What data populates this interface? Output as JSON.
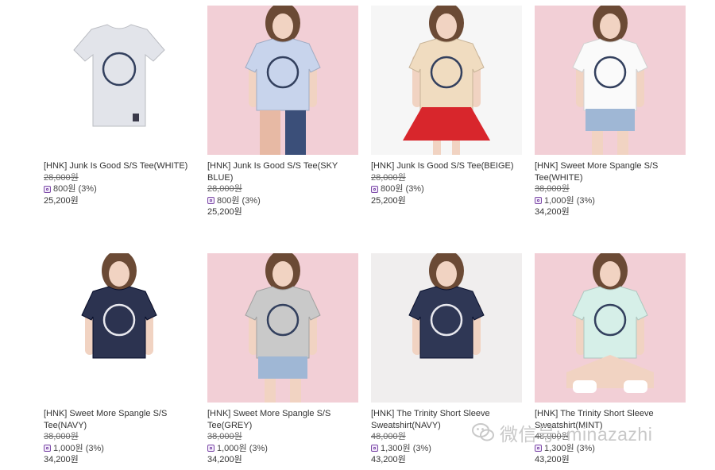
{
  "products": [
    {
      "name": "[HNK] Junk Is Good S/S Tee(WHITE)",
      "old_price": "28,000원",
      "mileage": "800원 (3%)",
      "price": "25,200원",
      "tee_color": "#e2e4ea",
      "bg": "#ffffff",
      "model": false,
      "bottom": "none"
    },
    {
      "name": "[HNK] Junk Is Good S/S Tee(SKY BLUE)",
      "old_price": "28,000원",
      "mileage": "800원 (3%)",
      "price": "25,200원",
      "tee_color": "#c8d4ec",
      "bg": "#f2cfd6",
      "model": true,
      "bottom": "pants"
    },
    {
      "name": "[HNK] Junk Is Good S/S Tee(BEIGE)",
      "old_price": "28,000원",
      "mileage": "800원 (3%)",
      "price": "25,200원",
      "tee_color": "#f0dcc0",
      "bg": "#f6f6f6",
      "model": true,
      "bottom": "red-skirt"
    },
    {
      "name": "[HNK] Sweet More Spangle S/S Tee(WHITE)",
      "old_price": "38,000원",
      "mileage": "1,000원 (3%)",
      "price": "34,200원",
      "tee_color": "#fafafa",
      "bg": "#f2cfd6",
      "model": true,
      "bottom": "denim-shorts"
    },
    {
      "name": "[HNK] Sweet More Spangle S/S Tee(NAVY)",
      "old_price": "38,000원",
      "mileage": "1,000원 (3%)",
      "price": "34,200원",
      "tee_color": "#2c3350",
      "bg": "#ffffff",
      "model": true,
      "bottom": "none"
    },
    {
      "name": "[HNK] Sweet More Spangle S/S Tee(GREY)",
      "old_price": "38,000원",
      "mileage": "1,000원 (3%)",
      "price": "34,200원",
      "tee_color": "#c9c9c9",
      "bg": "#f2cfd6",
      "model": true,
      "bottom": "denim-skirt"
    },
    {
      "name": "[HNK] The Trinity Short Sleeve Sweatshirt(NAVY)",
      "old_price": "48,000원",
      "mileage": "1,300원 (3%)",
      "price": "43,200원",
      "tee_color": "#2f3755",
      "bg": "#f0eeee",
      "model": true,
      "bottom": "none"
    },
    {
      "name": "[HNK] The Trinity Short Sleeve Sweatshirt(MINT)",
      "old_price": "48,000원",
      "mileage": "1,300원 (3%)",
      "price": "43,200원",
      "tee_color": "#d6efe8",
      "bg": "#f2cfd6",
      "model": true,
      "bottom": "sitting"
    }
  ],
  "watermark": {
    "text": "微信号: minazazhi"
  }
}
